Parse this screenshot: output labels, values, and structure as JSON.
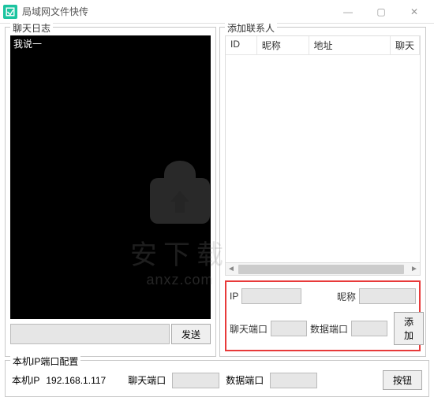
{
  "window": {
    "title": "局域网文件快传",
    "min": "—",
    "max": "▢",
    "close": "✕"
  },
  "chat": {
    "legend": "聊天日志",
    "log": "我说一",
    "send": "发送"
  },
  "contacts": {
    "legend": "添加联系人",
    "cols": {
      "id": "ID",
      "nick": "昵称",
      "addr": "地址",
      "chatport": "聊天"
    }
  },
  "addform": {
    "ip_label": "IP",
    "nick_label": "昵称",
    "chatport_label": "聊天端口",
    "dataport_label": "数据端口",
    "add": "添加"
  },
  "ipcfg": {
    "legend": "本机IP端口配置",
    "ip_label": "本机IP",
    "ip_value": "192.168.1.117",
    "chatport_label": "聊天端口",
    "dataport_label": "数据端口",
    "btn": "按钮"
  },
  "watermark": {
    "line1": "安下载",
    "line2": "anxz.com"
  }
}
